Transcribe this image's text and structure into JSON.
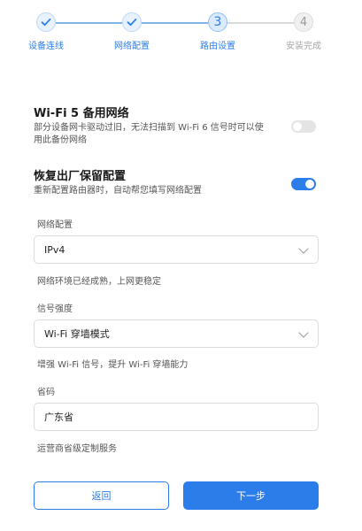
{
  "stepper": {
    "steps": [
      {
        "label": "设备连线",
        "state": "done"
      },
      {
        "label": "网络配置",
        "state": "done"
      },
      {
        "label": "路由设置",
        "state": "current",
        "number": "3"
      },
      {
        "label": "安装完成",
        "state": "todo",
        "number": "4"
      }
    ]
  },
  "wifi5_backup": {
    "title": "Wi-Fi 5 备用网络",
    "description": "部分设备网卡驱动过旧，无法扫描到 Wi-Fi 6 信号时可以使用此备份网络",
    "enabled": false
  },
  "restore_factory": {
    "title": "恢复出厂保留配置",
    "description": "重新配置路由器时，自动帮您填写网络配置",
    "enabled": true
  },
  "network_config": {
    "label": "网络配置",
    "selected": "IPv4",
    "hint": "网络环境已经成熟，上网更稳定"
  },
  "signal_strength": {
    "label": "信号强度",
    "selected": "Wi-Fi 穿墙模式",
    "hint": "增强 Wi-Fi 信号，提升 Wi-Fi 穿墙能力"
  },
  "province": {
    "label": "省码",
    "value": "广东省",
    "hint": "运营商省级定制服务"
  },
  "buttons": {
    "back_label": "返回",
    "next_label": "下一步"
  },
  "colors": {
    "accent": "#2b7de9",
    "toggle_off": "#e4e4e4",
    "border": "#dcdcdc"
  }
}
